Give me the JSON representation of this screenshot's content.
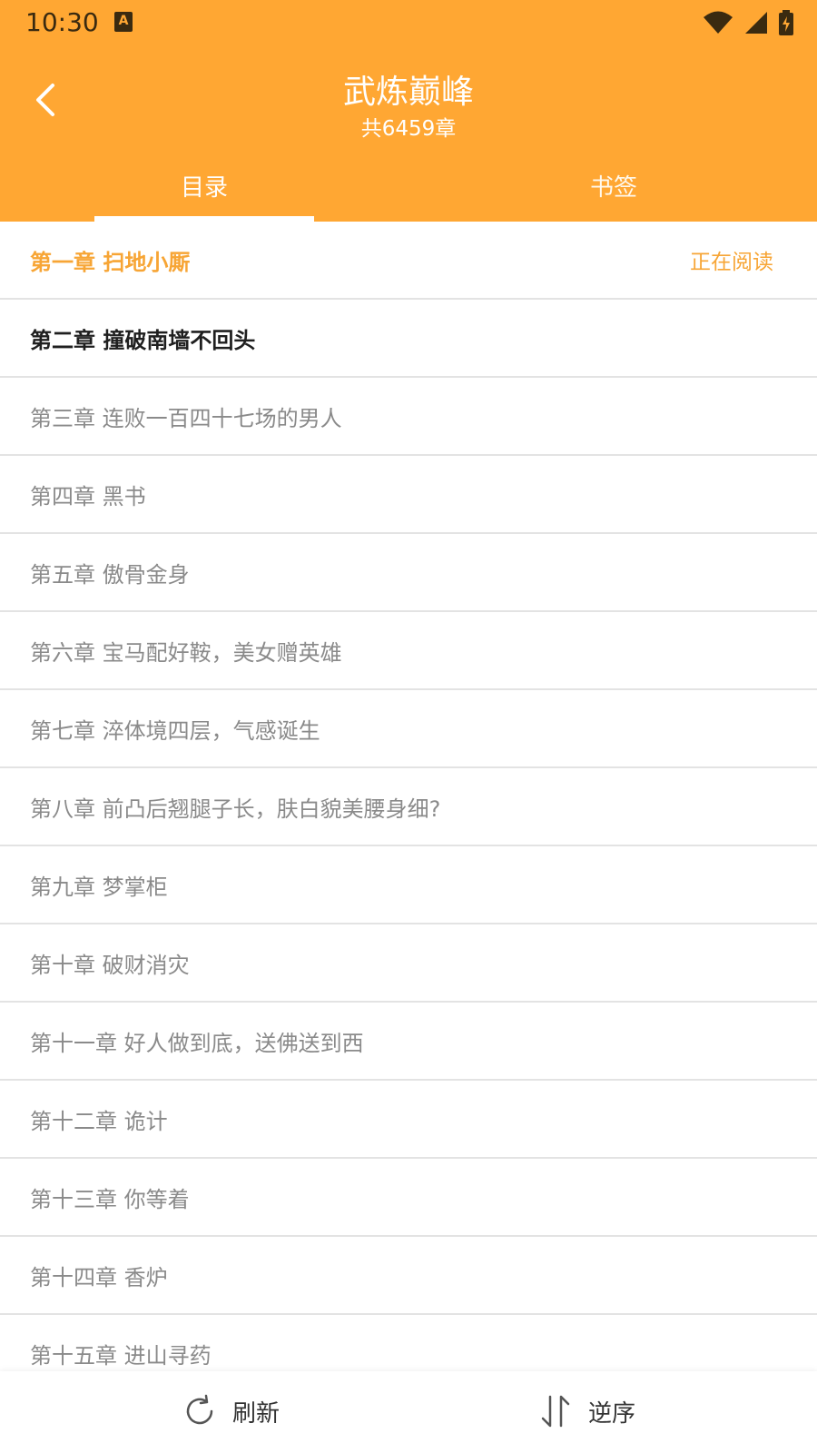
{
  "status_bar": {
    "time": "10:30",
    "notification_letter": "A"
  },
  "header": {
    "title": "武炼巅峰",
    "subtitle": "共6459章"
  },
  "tabs": [
    {
      "label": "目录"
    },
    {
      "label": "书签"
    }
  ],
  "chapters": [
    {
      "label": "第一章 扫地小厮",
      "status": "正在阅读"
    },
    {
      "label": "第二章 撞破南墙不回头"
    },
    {
      "label": "第三章 连败一百四十七场的男人"
    },
    {
      "label": "第四章 黑书"
    },
    {
      "label": "第五章 傲骨金身"
    },
    {
      "label": "第六章 宝马配好鞍，美女赠英雄"
    },
    {
      "label": "第七章 淬体境四层，气感诞生"
    },
    {
      "label": "第八章 前凸后翘腿子长，肤白貌美腰身细?"
    },
    {
      "label": "第九章 梦掌柜"
    },
    {
      "label": "第十章 破财消灾"
    },
    {
      "label": "第十一章 好人做到底，送佛送到西"
    },
    {
      "label": "第十二章 诡计"
    },
    {
      "label": "第十三章 你等着"
    },
    {
      "label": "第十四章 香炉"
    },
    {
      "label": "第十五章 进山寻药"
    }
  ],
  "bottom_bar": {
    "refresh_label": "刷新",
    "reverse_label": "逆序"
  },
  "colors": {
    "accent": "#FFA733",
    "current_text": "#F7A535"
  }
}
